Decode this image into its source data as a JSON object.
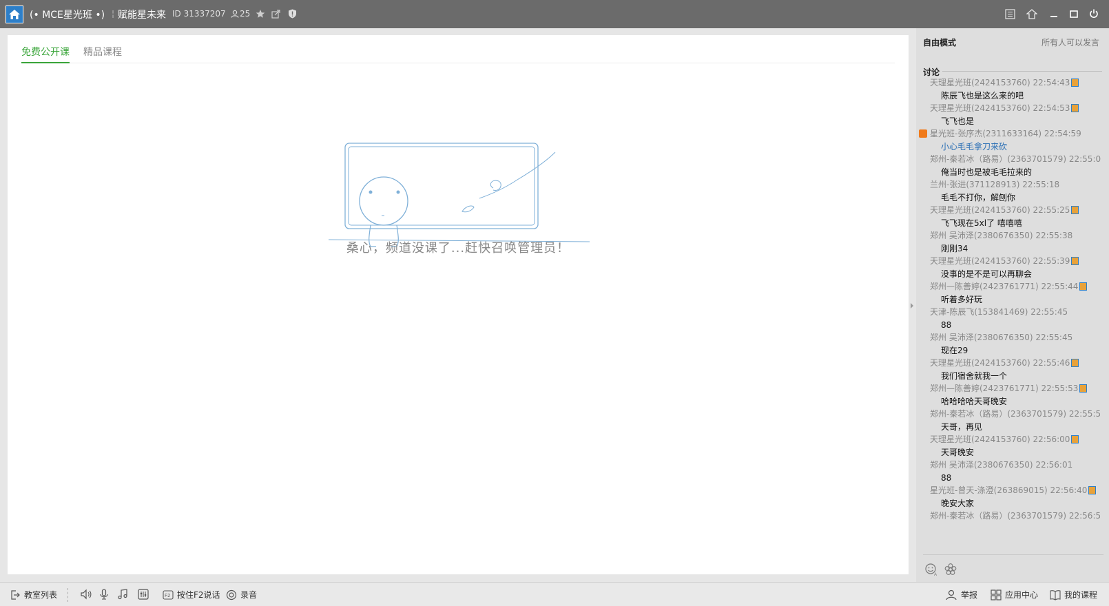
{
  "titlebar": {
    "channel_name": "(• MCE星光班 •)",
    "room_name": "赋能星未来",
    "id_text": "ID 31337207",
    "user_count": "25"
  },
  "tabs": [
    {
      "label": "免费公开课",
      "active": true
    },
    {
      "label": "精品课程",
      "active": false
    }
  ],
  "main": {
    "empty_message": "桑心，频道没课了...赶快召唤管理员！"
  },
  "sidebar": {
    "mode_label": "自由模式",
    "mode_status": "所有人可以发言",
    "discussion_title": "讨论",
    "messages": [
      {
        "sender": "天理星光班(2424153760) 22:54:43",
        "text": "陈辰飞也是这么来的吧",
        "badge": true
      },
      {
        "sender": "天理星光班(2424153760) 22:54:53",
        "text": "飞飞也是",
        "badge": true
      },
      {
        "sender": "星光班-张序杰(2311633164) 22:54:59",
        "text": "小心毛毛拿刀来砍",
        "gift": true,
        "blue": true
      },
      {
        "sender": "郑州-秦若冰（路易）(2363701579) 22:55:0",
        "text": "俺当时也是被毛毛拉来的"
      },
      {
        "sender": "兰州-张进(371128913) 22:55:18",
        "text": "毛毛不打你，解刨你"
      },
      {
        "sender": "天理星光班(2424153760) 22:55:25",
        "text": "飞飞现在5xl了 嘻嘻嘻",
        "badge": true
      },
      {
        "sender": "郑州 吴沛泽(2380676350) 22:55:38",
        "text": "刚刚34"
      },
      {
        "sender": "天理星光班(2424153760) 22:55:39",
        "text": "没事的是不是可以再聊会",
        "badge": true
      },
      {
        "sender": "郑州—陈善婷(2423761771) 22:55:44",
        "text": "听着多好玩",
        "badge": true
      },
      {
        "sender": "天津-陈辰飞(153841469) 22:55:45",
        "text": "88"
      },
      {
        "sender": "郑州 吴沛泽(2380676350) 22:55:45",
        "text": "现在29"
      },
      {
        "sender": "天理星光班(2424153760) 22:55:46",
        "text": "我们宿舍就我一个",
        "badge": true
      },
      {
        "sender": "郑州—陈善婷(2423761771) 22:55:53",
        "text": "哈哈哈哈天哥晚安",
        "badge": true
      },
      {
        "sender": "郑州-秦若冰（路易）(2363701579) 22:55:5",
        "text": "天哥，再见"
      },
      {
        "sender": "天理星光班(2424153760) 22:56:00",
        "text": "天哥晚安",
        "badge": true
      },
      {
        "sender": "郑州 吴沛泽(2380676350) 22:56:01",
        "text": "88"
      },
      {
        "sender": "星光班-曾天-涤澄(263869015) 22:56:40",
        "text": "晚安大家",
        "badge": true
      },
      {
        "sender": "郑州-秦若冰（路易）(2363701579) 22:56:5",
        "text": ""
      }
    ]
  },
  "bottombar": {
    "classroom_list": "教室列表",
    "push_to_talk": "按住F2说话",
    "record": "录音",
    "report": "举报",
    "app_center": "应用中心",
    "my_courses": "我的课程"
  },
  "colors": {
    "titlebar_bg": "#6b6b6b",
    "accent_green": "#3aa53a",
    "link_blue": "#2a6fb5"
  }
}
